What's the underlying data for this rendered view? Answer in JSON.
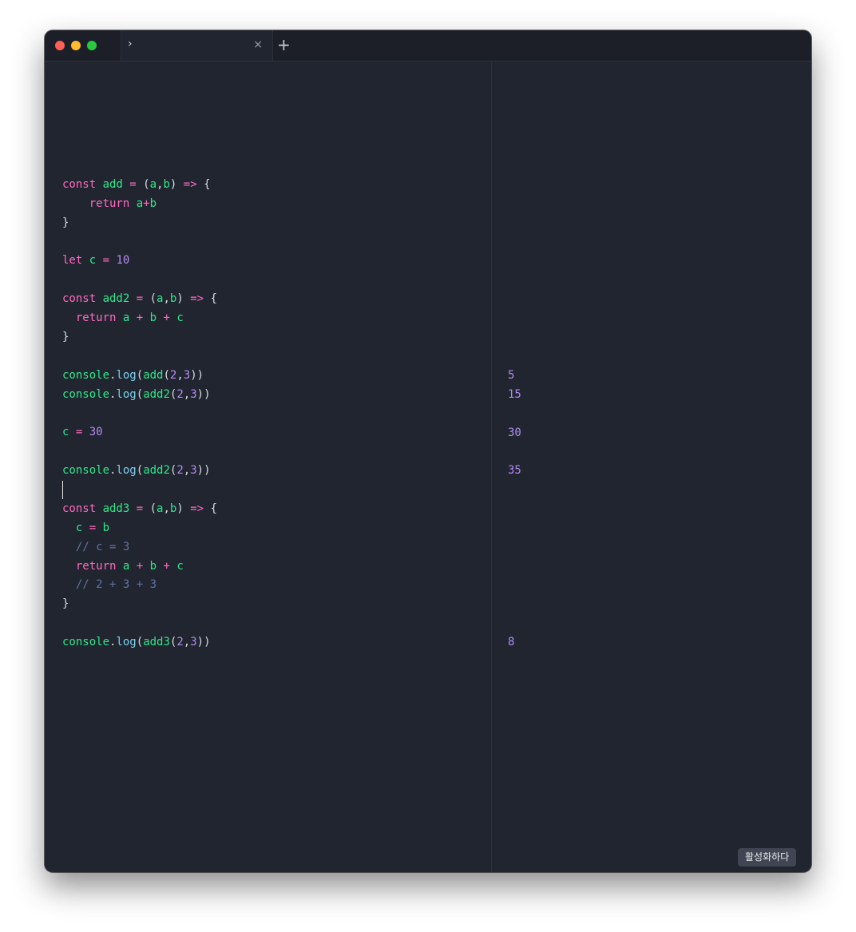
{
  "tab": {
    "title": "",
    "chevron": "›",
    "close": "×"
  },
  "toolbar": {
    "new_tab": "+"
  },
  "code_lines": [
    [],
    [],
    [
      [
        "kw",
        "const "
      ],
      [
        "fn",
        "add"
      ],
      [
        "op",
        " = "
      ],
      [
        "pn",
        "("
      ],
      [
        "id",
        "a"
      ],
      [
        "pn",
        ","
      ],
      [
        "id",
        "b"
      ],
      [
        "pn",
        ") "
      ],
      [
        "op",
        "=>"
      ],
      [
        "pn",
        " {"
      ]
    ],
    [
      [
        "kw",
        "    return "
      ],
      [
        "id",
        "a"
      ],
      [
        "op",
        "+"
      ],
      [
        "id",
        "b"
      ]
    ],
    [
      [
        "pn",
        "}"
      ]
    ],
    [],
    [
      [
        "kw",
        "let "
      ],
      [
        "id",
        "c"
      ],
      [
        "op",
        " = "
      ],
      [
        "num",
        "10"
      ]
    ],
    [],
    [
      [
        "kw",
        "const "
      ],
      [
        "fn",
        "add2"
      ],
      [
        "op",
        " = "
      ],
      [
        "pn",
        "("
      ],
      [
        "id",
        "a"
      ],
      [
        "pn",
        ","
      ],
      [
        "id",
        "b"
      ],
      [
        "pn",
        ") "
      ],
      [
        "op",
        "=>"
      ],
      [
        "pn",
        " {"
      ]
    ],
    [
      [
        "kw",
        "  return "
      ],
      [
        "id",
        "a"
      ],
      [
        "op",
        " + "
      ],
      [
        "id",
        "b"
      ],
      [
        "op",
        " + "
      ],
      [
        "id",
        "c"
      ]
    ],
    [
      [
        "pn",
        "}"
      ]
    ],
    [],
    [
      [
        "id",
        "console"
      ],
      [
        "pn",
        "."
      ],
      [
        "mth",
        "log"
      ],
      [
        "pn",
        "("
      ],
      [
        "fn",
        "add"
      ],
      [
        "pn",
        "("
      ],
      [
        "num",
        "2"
      ],
      [
        "pn",
        ","
      ],
      [
        "num",
        "3"
      ],
      [
        "pn",
        "))"
      ]
    ],
    [
      [
        "id",
        "console"
      ],
      [
        "pn",
        "."
      ],
      [
        "mth",
        "log"
      ],
      [
        "pn",
        "("
      ],
      [
        "fn",
        "add2"
      ],
      [
        "pn",
        "("
      ],
      [
        "num",
        "2"
      ],
      [
        "pn",
        ","
      ],
      [
        "num",
        "3"
      ],
      [
        "pn",
        "))"
      ]
    ],
    [],
    [
      [
        "id",
        "c"
      ],
      [
        "op",
        " = "
      ],
      [
        "num",
        "30"
      ]
    ],
    [],
    [
      [
        "id",
        "console"
      ],
      [
        "pn",
        "."
      ],
      [
        "mth",
        "log"
      ],
      [
        "pn",
        "("
      ],
      [
        "fn",
        "add2"
      ],
      [
        "pn",
        "("
      ],
      [
        "num",
        "2"
      ],
      [
        "pn",
        ","
      ],
      [
        "num",
        "3"
      ],
      [
        "pn",
        "))"
      ]
    ],
    [],
    [
      [
        "kw",
        "const "
      ],
      [
        "fn",
        "add3"
      ],
      [
        "op",
        " = "
      ],
      [
        "pn",
        "("
      ],
      [
        "id",
        "a"
      ],
      [
        "pn",
        ","
      ],
      [
        "id",
        "b"
      ],
      [
        "pn",
        ") "
      ],
      [
        "op",
        "=>"
      ],
      [
        "pn",
        " {"
      ]
    ],
    [
      [
        "id",
        "  c"
      ],
      [
        "op",
        " = "
      ],
      [
        "id",
        "b"
      ]
    ],
    [
      [
        "cm",
        "  // c = 3"
      ]
    ],
    [
      [
        "kw",
        "  return "
      ],
      [
        "id",
        "a"
      ],
      [
        "op",
        " + "
      ],
      [
        "id",
        "b"
      ],
      [
        "op",
        " + "
      ],
      [
        "id",
        "c"
      ]
    ],
    [
      [
        "cm",
        "  // 2 + 3 + 3"
      ]
    ],
    [
      [
        "pn",
        "}"
      ]
    ],
    [],
    [
      [
        "id",
        "console"
      ],
      [
        "pn",
        "."
      ],
      [
        "mth",
        "log"
      ],
      [
        "pn",
        "("
      ],
      [
        "fn",
        "add3"
      ],
      [
        "pn",
        "("
      ],
      [
        "num",
        "2"
      ],
      [
        "pn",
        ","
      ],
      [
        "num",
        "3"
      ],
      [
        "pn",
        "))"
      ]
    ]
  ],
  "cursor_line": 18,
  "results": [
    {
      "line": 12,
      "value": "5"
    },
    {
      "line": 13,
      "value": "15"
    },
    {
      "line": 15,
      "value": "30"
    },
    {
      "line": 17,
      "value": "35"
    },
    {
      "line": 26,
      "value": "8"
    }
  ],
  "activate_button": "활성화하다",
  "colors": {
    "keyword": "#ff6ac1",
    "identifier": "#30e88a",
    "number": "#b48cf6",
    "method": "#7bd3f2",
    "comment": "#6272a4",
    "background": "#21252f"
  }
}
